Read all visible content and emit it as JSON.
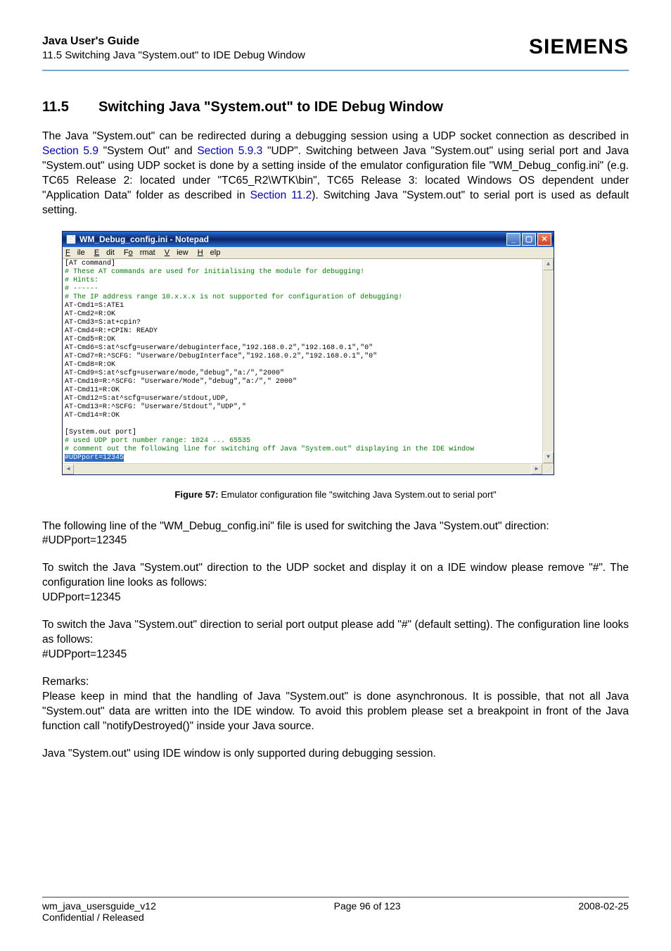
{
  "header": {
    "doc_title": "Java User's Guide",
    "doc_subtitle": "11.5 Switching Java \"System.out\" to IDE Debug Window",
    "brand": "SIEMENS"
  },
  "section": {
    "number": "11.5",
    "title": "Switching Java \"System.out\" to IDE Debug Window"
  },
  "para1": {
    "t1": "The Java \"System.out\" can be redirected during a debugging session using a UDP socket connection as described in ",
    "link1": "Section 5.9",
    "t2": " \"System Out\" and ",
    "link2": "Section 5.9.3",
    "t3": " \"UDP\".  Switching between Java \"System.out\" using serial port and Java \"System.out\" using UDP socket is done by a setting inside of the emulator configuration file \"WM_Debug_config.ini\" (e.g. TC65 Release 2: located under \"TC65_R2\\WTK\\bin\", TC65 Release 3: located Windows OS dependent under \"Application Data\" folder as described in ",
    "link3": "Section 11.2",
    "t4": "). Switching Java \"System.out\" to serial port is used as default setting."
  },
  "notepad": {
    "title": "WM_Debug_config.ini - Notepad",
    "menu": {
      "file": "File",
      "edit": "Edit",
      "format": "Format",
      "view": "View",
      "help": "Help"
    },
    "lines": {
      "l1": "[AT command]",
      "c1": "# These AT commands are used for initialising the module for debugging!",
      "c2": "# Hints:",
      "c3": "# ------",
      "c4": "# The IP address range 10.x.x.x is not supported for configuration of debugging!",
      "l2": "AT-Cmd1=S:ATE1",
      "l3": "AT-Cmd2=R:OK",
      "l4": "AT-Cmd3=S:at+cpin?",
      "l5": "AT-Cmd4=R:+CPIN: READY",
      "l6": "AT-Cmd5=R:OK",
      "l7": "AT-Cmd6=S:at^scfg=userware/debuginterface,\"192.168.0.2\",\"192.168.0.1\",\"0\"",
      "l8": "AT-Cmd7=R:^SCFG: \"Userware/DebugInterface\",\"192.168.0.2\",\"192.168.0.1\",\"0\"",
      "l9": "AT-Cmd8=R:OK",
      "l10": "AT-Cmd9=S:at^scfg=userware/mode,\"debug\",\"a:/\",\"2000\"",
      "l11": "AT-Cmd10=R:^SCFG: \"Userware/Mode\",\"debug\",\"a:/\",\" 2000\"",
      "l12": "AT-Cmd11=R:OK",
      "l13": "AT-Cmd12=S:at^scfg=userware/stdout,UDP,",
      "l14": "AT-Cmd13=R:^SCFG: \"Userware/Stdout\",\"UDP\",\"",
      "l15": "AT-Cmd14=R:OK",
      "l16": "",
      "l17": "[System.out port]",
      "c5": "# used UDP port number range: 1024 ... 65535",
      "c6": "# comment out the following line for switching off Java \"System.out\" displaying in the IDE window",
      "hl": "#UDPport=12345"
    }
  },
  "figure_caption": {
    "label": "Figure 57:",
    "text": "  Emulator configuration file \"switching Java System.out to serial port\""
  },
  "para2": "The following line of the \"WM_Debug_config.ini\" file is used for switching the Java \"System.out\" direction:",
  "para2b": "#UDPport=12345",
  "para3": "To switch the Java \"System.out\" direction to the UDP socket and display it on a IDE window please remove \"#\". The configuration line looks as follows:",
  "para3b": "UDPport=12345",
  "para4": "To switch the Java \"System.out\" direction to serial port output please add \"#\" (default setting). The configuration line looks as follows:",
  "para4b": "#UDPport=12345",
  "para5a": "Remarks:",
  "para5": "Please keep in mind that the handling of Java \"System.out\" is done asynchronous. It is possible, that not all Java \"System.out\" data are written into the IDE window. To avoid this problem please set a breakpoint in front of the Java function call \"notifyDestroyed()\" inside your Java source.",
  "para6": "Java \"System.out\" using IDE window is only supported during debugging session.",
  "footer": {
    "left1": "wm_java_usersguide_v12",
    "left2": "Confidential / Released",
    "center": "Page 96 of 123",
    "right": "2008-02-25"
  }
}
